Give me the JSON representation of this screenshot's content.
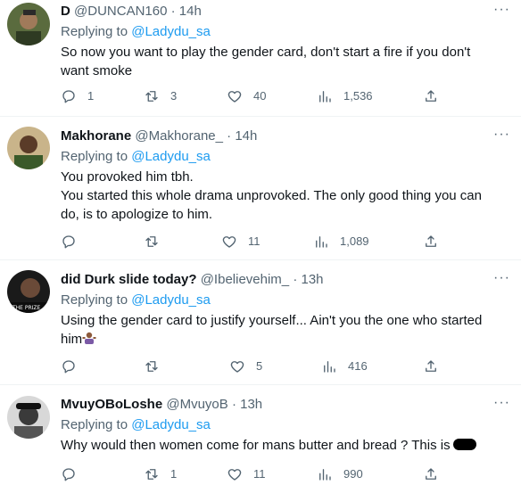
{
  "tweets": [
    {
      "name": "D",
      "handle": "@DUNCAN160",
      "time": "14h",
      "replying_prefix": "Replying to",
      "replying_to": "@Ladydu_sa",
      "text_lines": [
        "So now you want to play the gender card, don't start a fire if you don't",
        "want smoke"
      ],
      "replies": "1",
      "retweets": "3",
      "likes": "40",
      "views": "1,536"
    },
    {
      "name": "Makhorane",
      "handle": "@Makhorane_",
      "time": "14h",
      "replying_prefix": "Replying to",
      "replying_to": "@Ladydu_sa",
      "text_lines": [
        "You provoked him tbh.",
        "You started this whole drama unprovoked. The only good thing you can",
        "do, is to apologize to him."
      ],
      "replies": "",
      "retweets": "",
      "likes": "11",
      "views": "1,089"
    },
    {
      "name": "did Durk slide today?",
      "handle": "@Ibelievehim_",
      "time": "13h",
      "replying_prefix": "Replying to",
      "replying_to": "@Ladydu_sa",
      "avatar_text": "THE PRIZE",
      "text_lines": [
        "Using the gender card to justify yourself... Ain't you the one who started",
        "him"
      ],
      "replies": "",
      "retweets": "",
      "likes": "5",
      "views": "416"
    },
    {
      "name": "MvuyOBoLoshe",
      "handle": "@MvuyoB",
      "time": "13h",
      "replying_prefix": "Replying to",
      "replying_to": "@Ladydu_sa",
      "text_lines": [
        "Why would then women come for mans butter and bread ? This is"
      ],
      "replies": "",
      "retweets": "1",
      "likes": "11",
      "views": "990"
    }
  ],
  "more_glyph": "···",
  "dot_separator": "·"
}
